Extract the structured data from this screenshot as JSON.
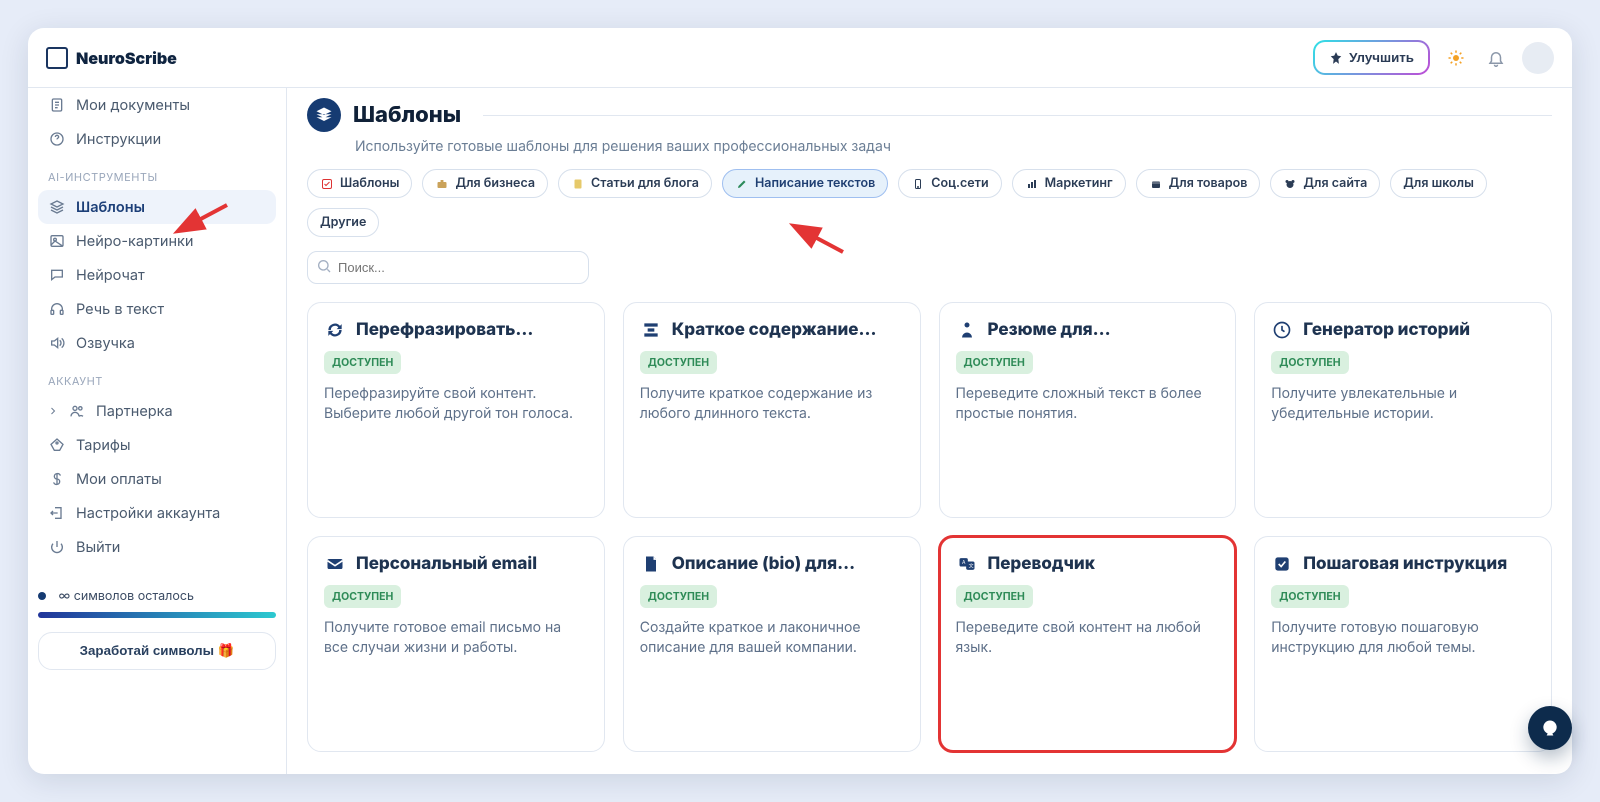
{
  "brand": {
    "name": "NeuroScribe"
  },
  "header": {
    "improve_label": "Улучшить",
    "sun_title": "Светлая тема",
    "bell_title": "Уведомления",
    "avatar_title": "Профиль"
  },
  "sidebar": {
    "top": [
      {
        "label": "Мои документы",
        "icon": "doc"
      },
      {
        "label": "Инструкции",
        "icon": "help"
      }
    ],
    "group_ai_label": "AI-ИНСТРУМЕНТЫ",
    "ai": [
      {
        "label": "Шаблоны",
        "icon": "layers",
        "active": true
      },
      {
        "label": "Нейро-картинки",
        "icon": "image"
      },
      {
        "label": "Нейрочат",
        "icon": "chat"
      },
      {
        "label": "Речь в текст",
        "icon": "headphones"
      },
      {
        "label": "Озвучка",
        "icon": "sound"
      }
    ],
    "group_account_label": "АККАУНТ",
    "account": [
      {
        "label": "Партнерка",
        "icon": "users",
        "chevron": true
      },
      {
        "label": "Тарифы",
        "icon": "tag"
      },
      {
        "label": "Мои оплаты",
        "icon": "dollar"
      },
      {
        "label": "Настройки аккаунта",
        "icon": "logout-settings"
      },
      {
        "label": "Выйти",
        "icon": "power"
      }
    ],
    "symbols_label": "∞ символов осталось",
    "earn_label": "Заработай символы 🎁"
  },
  "page": {
    "title": "Шаблоны",
    "subtitle": "Используйте готовые шаблоны для решения ваших профессиональных задач",
    "search_placeholder": "Поиск..."
  },
  "filters": [
    {
      "label": "Шаблоны",
      "icon": "check",
      "active": false
    },
    {
      "label": "Для бизнеса",
      "icon": "briefcase",
      "active": false
    },
    {
      "label": "Статьи для блога",
      "icon": "note",
      "active": false
    },
    {
      "label": "Написание текстов",
      "icon": "pen",
      "active": true
    },
    {
      "label": "Соц.сети",
      "icon": "phone",
      "active": false
    },
    {
      "label": "Маркетинг",
      "icon": "chart",
      "active": false
    },
    {
      "label": "Для товаров",
      "icon": "box",
      "active": false
    },
    {
      "label": "Для сайта",
      "icon": "panda",
      "active": false
    },
    {
      "label": "Для школы",
      "icon": "",
      "active": false
    },
    {
      "label": "Другие",
      "icon": "",
      "active": false
    }
  ],
  "badge_label": "ДОСТУПЕН",
  "cards": [
    {
      "title": "Перефразировать...",
      "icon": "refresh",
      "desc": "Перефразируйте свой контент. Выберите любой другой тон голоса."
    },
    {
      "title": "Краткое содержание...",
      "icon": "compress",
      "desc": "Получите краткое содержание из любого длинного текста."
    },
    {
      "title": "Резюме для...",
      "icon": "person",
      "desc": "Переведите сложный текст в более простые понятия."
    },
    {
      "title": "Генератор историй",
      "icon": "clock",
      "desc": "Получите увлекательные и убедительные истории."
    },
    {
      "title": "Персональный email",
      "icon": "mail",
      "desc": "Получите готовое email письмо на все случаи жизни и работы."
    },
    {
      "title": "Описание (bio) для...",
      "icon": "doc2",
      "desc": "Создайте краткое и лаконичное описание для вашей компании."
    },
    {
      "title": "Переводчик",
      "icon": "translate",
      "desc": "Переведите свой контент на любой язык.",
      "highlight": true
    },
    {
      "title": "Пошаговая инструкция",
      "icon": "checkbox",
      "desc": "Получите готовую пошаговую инструкцию для любой темы."
    }
  ]
}
